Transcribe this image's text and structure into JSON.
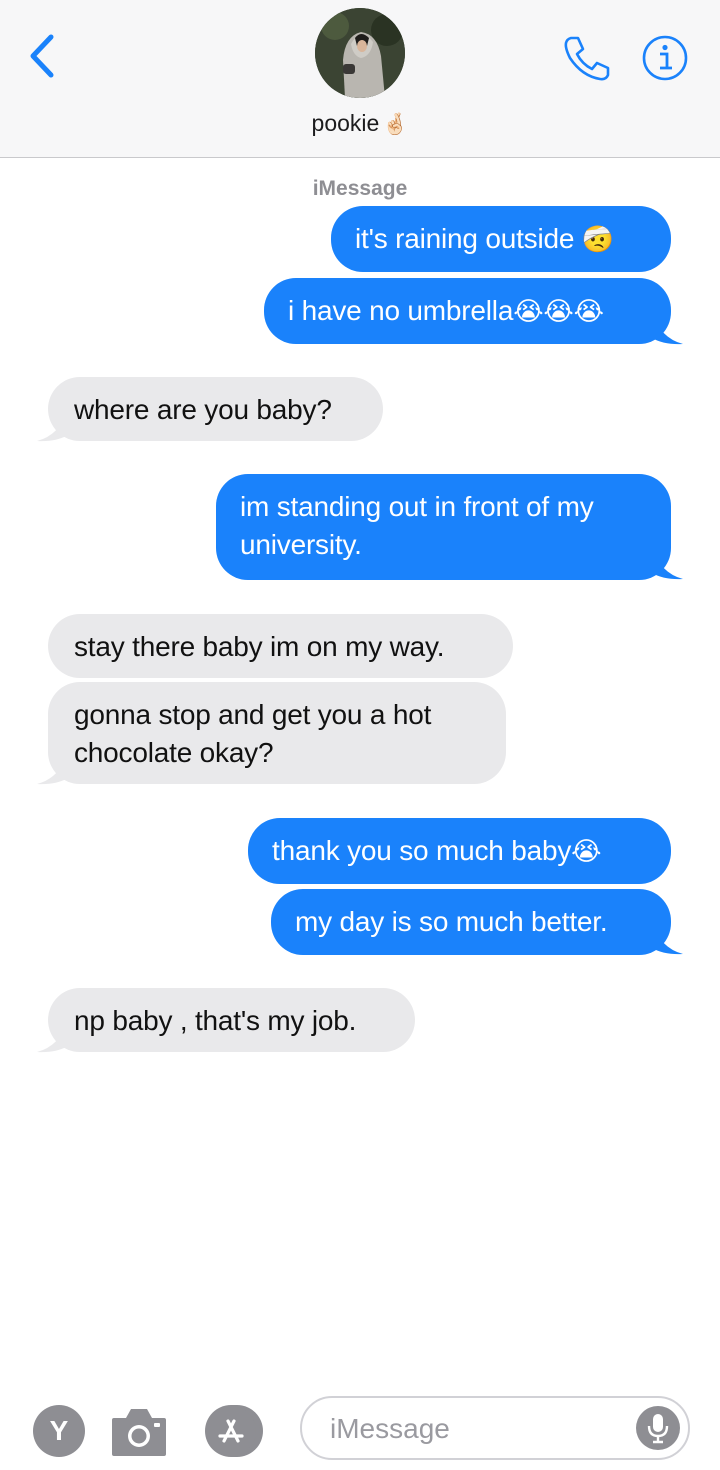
{
  "header": {
    "contact_name": "pookie",
    "contact_emoji": "🤞🏻",
    "back_icon": "chevron-left-icon",
    "call_icon": "phone-icon",
    "info_icon": "info-icon"
  },
  "conversation": {
    "service_label": "iMessage",
    "messages": [
      {
        "direction": "outgoing",
        "text": "it's raining outside ",
        "emoji": "🤕"
      },
      {
        "direction": "outgoing",
        "text": "i have no umbrella",
        "emoji": "😭😭😭"
      },
      {
        "direction": "incoming",
        "text": "where are you baby?",
        "emoji": ""
      },
      {
        "direction": "outgoing",
        "text": "im standing out in front of my",
        "text2": "university.",
        "emoji": ""
      },
      {
        "direction": "incoming",
        "text": "stay there baby im on my way.",
        "emoji": ""
      },
      {
        "direction": "incoming",
        "text": "gonna stop and get you a hot",
        "text2": "chocolate okay?",
        "emoji": ""
      },
      {
        "direction": "outgoing",
        "text": "thank you so much baby",
        "emoji": "😭"
      },
      {
        "direction": "outgoing",
        "text": "my day is so much better.",
        "emoji": ""
      },
      {
        "direction": "incoming",
        "text": "np baby , that's my job.",
        "emoji": ""
      }
    ]
  },
  "input_bar": {
    "placeholder": "iMessage",
    "app_letter": "Y",
    "camera_icon": "camera-icon",
    "appstore_icon": "app-store-icon",
    "mic_icon": "microphone-icon"
  },
  "colors": {
    "outgoing_bubble": "#1a82fb",
    "incoming_bubble": "#e9e9eb",
    "accent": "#1a82fb",
    "header_bg": "#f7f7f8"
  }
}
